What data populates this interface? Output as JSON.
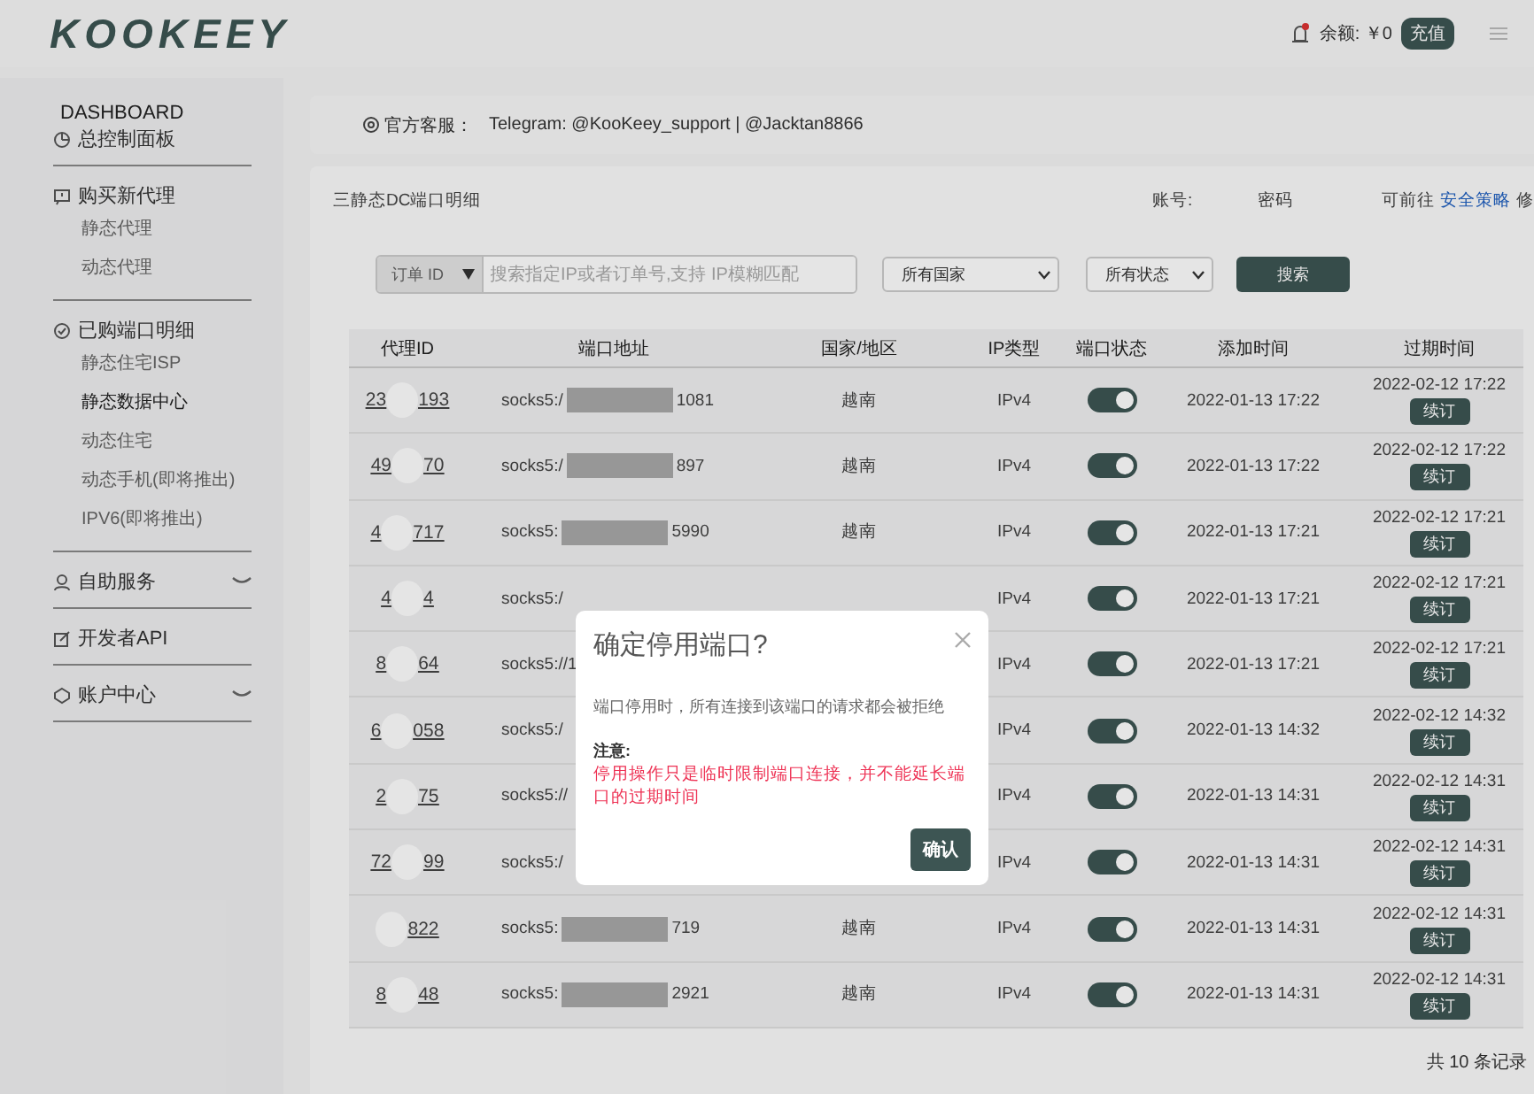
{
  "header": {
    "logo": "KOOKEEY",
    "balance": "余额: ￥0",
    "recharge_button": "充值"
  },
  "sidebar": {
    "title": "DASHBOARD",
    "sections": [
      {
        "label": "总控制面板",
        "expandable": false
      },
      {
        "label": "购买新代理",
        "expandable": false,
        "children": [
          {
            "label": "静态代理",
            "selected": false
          },
          {
            "label": "动态代理",
            "selected": false
          }
        ]
      },
      {
        "label": "已购端口明细",
        "expandable": false,
        "children": [
          {
            "label": "静态住宅ISP",
            "selected": false
          },
          {
            "label": "静态数据中心",
            "selected": true
          },
          {
            "label": "动态住宅",
            "selected": false
          },
          {
            "label": "动态手机(即将推出)",
            "selected": false
          },
          {
            "label": "IPV6(即将推出)",
            "selected": false
          }
        ]
      },
      {
        "label": "自助服务",
        "expandable": true
      },
      {
        "label": "开发者API",
        "expandable": false
      },
      {
        "label": "账户中心",
        "expandable": true
      }
    ]
  },
  "notice": {
    "label": "官方客服：",
    "text": "Telegram: @KooKeey_support | @Jacktan8866"
  },
  "panel": {
    "title": "三静态DC端口明细",
    "account_label": "账号:",
    "password_label": "密码",
    "hint_before": "可前往",
    "hint_link": "安全策略",
    "hint_after": "修"
  },
  "filters": {
    "type_select": "订单 ID",
    "search_placeholder": "搜索指定IP或者订单号,支持 IP模糊匹配",
    "country_select": "所有国家",
    "status_select": "所有状态",
    "search_button": "搜索"
  },
  "table": {
    "columns": [
      "代理ID",
      "端口地址",
      "国家/地区",
      "IP类型",
      "端口状态",
      "添加时间",
      "过期时间"
    ],
    "rows": [
      {
        "id_start": "23",
        "id_end": "193",
        "address_start": "socks5:/",
        "address_end": "1081",
        "country": "越南",
        "ip_type": "IPv4",
        "on": true,
        "added": "2022-01-13 17:22",
        "expires": "2022-02-12 17:22",
        "renew": "续订"
      },
      {
        "id_start": "49",
        "id_end": "70",
        "address_start": "socks5:/",
        "address_end": "897",
        "country": "越南",
        "ip_type": "IPv4",
        "on": true,
        "added": "2022-01-13 17:22",
        "expires": "2022-02-12 17:22",
        "renew": "续订"
      },
      {
        "id_start": "4",
        "id_end": "717",
        "address_start": "socks5:",
        "address_end": "5990",
        "country": "越南",
        "ip_type": "IPv4",
        "on": true,
        "added": "2022-01-13 17:21",
        "expires": "2022-02-12 17:21",
        "renew": "续订"
      },
      {
        "id_start": "4",
        "id_end": "4",
        "address_start": "socks5:/",
        "ip_type": "IPv4",
        "on": true,
        "added": "2022-01-13 17:21",
        "expires": "2022-02-12 17:21",
        "renew": "续订"
      },
      {
        "id_start": "8",
        "id_end": "64",
        "address_start": "socks5://1",
        "ip_type": "IPv4",
        "on": true,
        "added": "2022-01-13 17:21",
        "expires": "2022-02-12 17:21",
        "renew": "续订"
      },
      {
        "id_start": "6",
        "id_end": "058",
        "address_start": "socks5:/",
        "ip_type": "IPv4",
        "on": true,
        "added": "2022-01-13 14:32",
        "expires": "2022-02-12 14:32",
        "renew": "续订"
      },
      {
        "id_start": "2",
        "id_end": "75",
        "address_start": "socks5://",
        "ip_type": "IPv4",
        "on": true,
        "added": "2022-01-13 14:31",
        "expires": "2022-02-12 14:31",
        "renew": "续订"
      },
      {
        "id_start": "72",
        "id_end": "99",
        "address_start": "socks5:/",
        "ip_type": "IPv4",
        "on": true,
        "added": "2022-01-13 14:31",
        "expires": "2022-02-12 14:31",
        "renew": "续订"
      },
      {
        "id_end": "822",
        "address_start": "socks5:",
        "address_end": "719",
        "country": "越南",
        "ip_type": "IPv4",
        "on": true,
        "added": "2022-01-13 14:31",
        "expires": "2022-02-12 14:31",
        "renew": "续订"
      },
      {
        "id_start": "8",
        "id_end": "48",
        "address_start": "socks5:",
        "address_end": "2921",
        "country": "越南",
        "ip_type": "IPv4",
        "on": true,
        "added": "2022-01-13 14:31",
        "expires": "2022-02-12 14:31",
        "renew": "续订"
      }
    ],
    "footer": "共 10 条记录"
  },
  "dialog": {
    "title": "确定停用端口?",
    "message": "端口停用时，所有连接到该端口的请求都会被拒绝",
    "note_label": "注意:",
    "warning": "停用操作只是临时限制端口连接，并不能延长端口的过期时间",
    "confirm_button": "确认"
  }
}
